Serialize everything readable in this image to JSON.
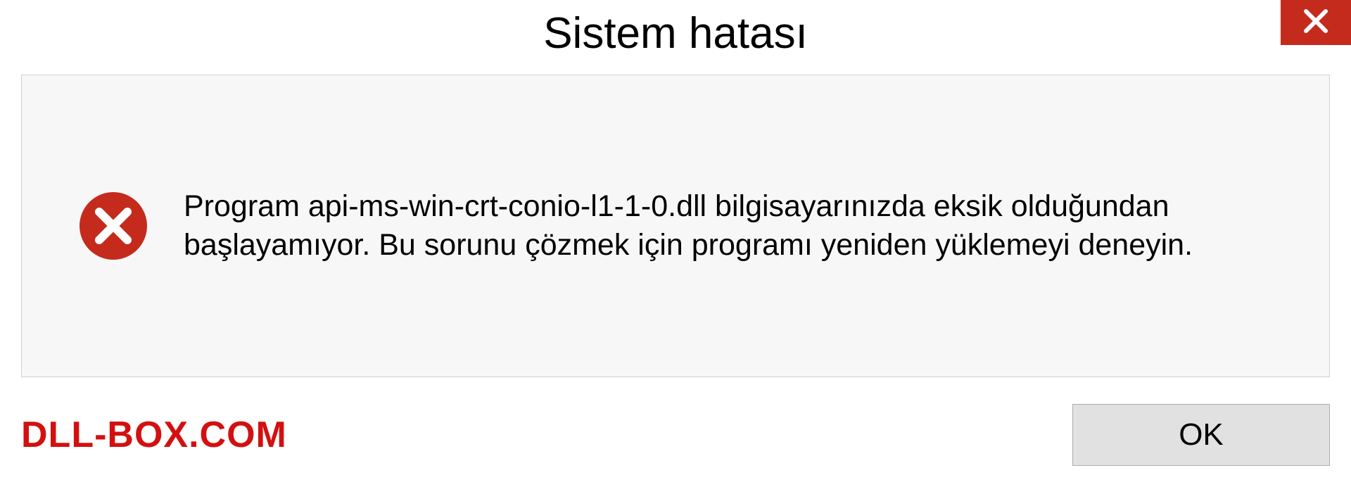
{
  "dialog": {
    "title": "Sistem hatası",
    "message": "Program api-ms-win-crt-conio-l1-1-0.dll bilgisayarınızda eksik olduğundan başlayamıyor. Bu sorunu çözmek için programı yeniden yüklemeyi deneyin.",
    "ok_label": "OK"
  },
  "watermark": "DLL-BOX.COM"
}
